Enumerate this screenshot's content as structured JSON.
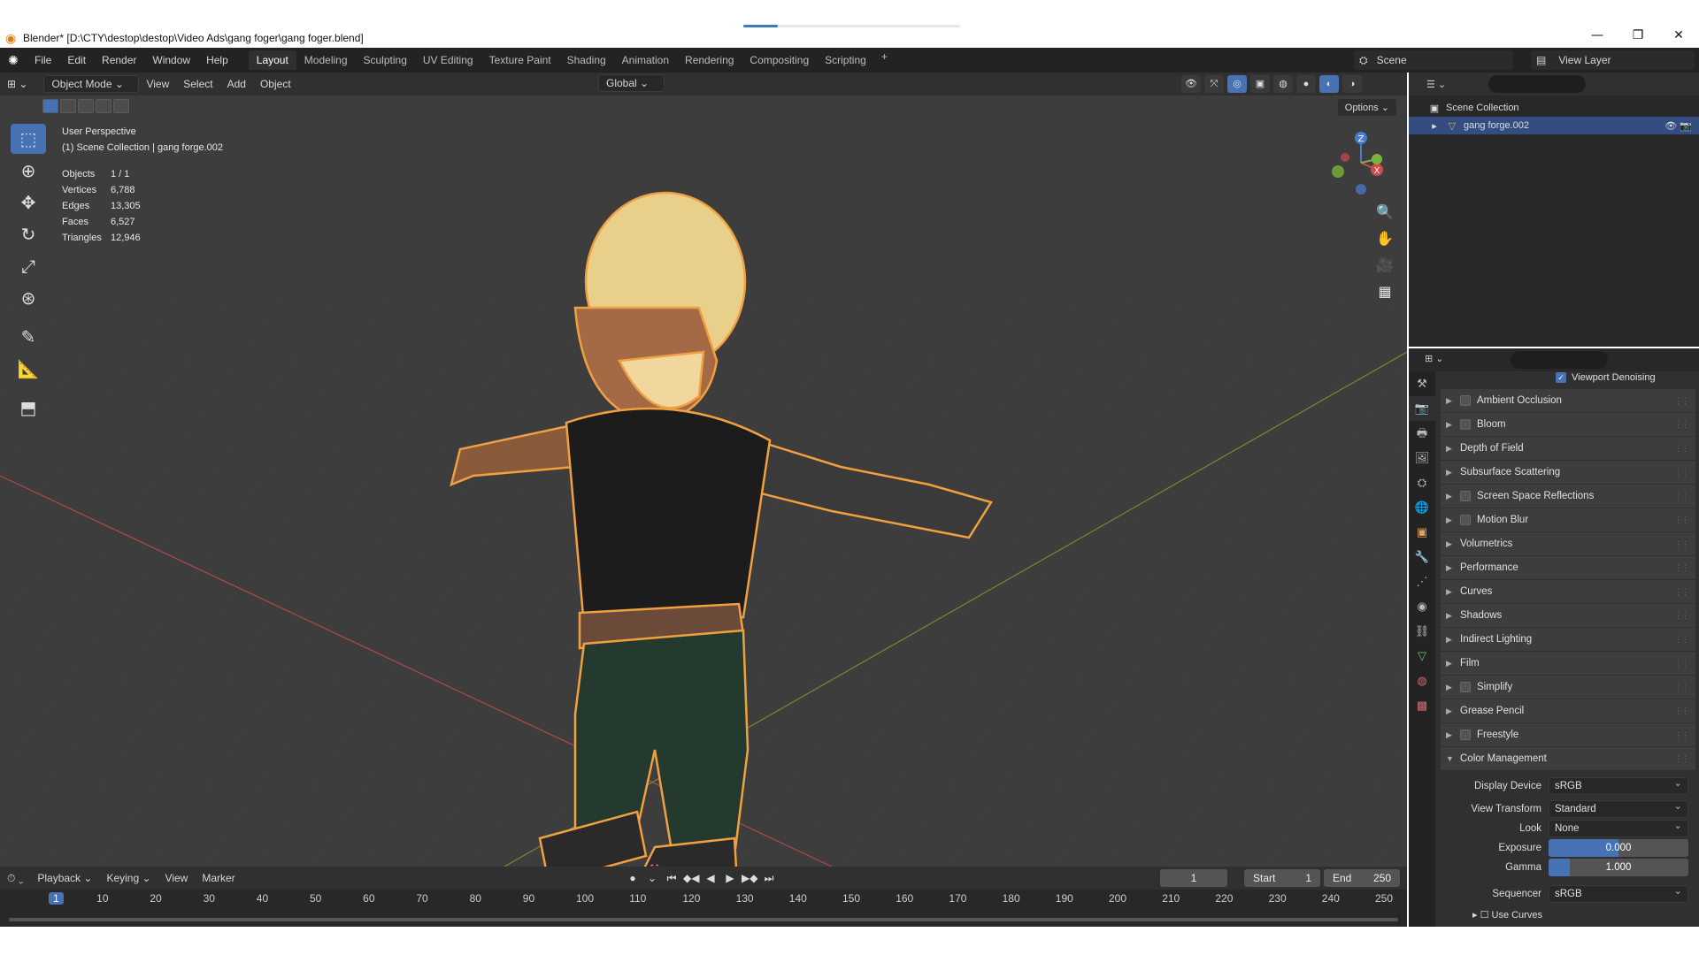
{
  "window": {
    "title": "Blender* [D:\\CTY\\destop\\destop\\Video Ads\\gang foger\\gang  foger.blend]",
    "controls": [
      "—",
      "❐",
      "✕"
    ]
  },
  "topbar": {
    "menus": [
      "File",
      "Edit",
      "Render",
      "Window",
      "Help"
    ],
    "workspaces": [
      "Layout",
      "Modeling",
      "Sculpting",
      "UV Editing",
      "Texture Paint",
      "Shading",
      "Animation",
      "Rendering",
      "Compositing",
      "Scripting"
    ],
    "add_tab": "+",
    "scene": "Scene",
    "view_layer": "View Layer"
  },
  "viewport_header": {
    "mode": "Object Mode",
    "menus": [
      "View",
      "Select",
      "Add",
      "Object"
    ],
    "orientation": "Global",
    "options": "Options"
  },
  "viewport": {
    "perspective": "User Perspective",
    "collection": "(1) Scene Collection | gang forge.002",
    "stats": [
      {
        "k": "Objects",
        "v": "1 / 1"
      },
      {
        "k": "Vertices",
        "v": "6,788"
      },
      {
        "k": "Edges",
        "v": "13,305"
      },
      {
        "k": "Faces",
        "v": "6,527"
      },
      {
        "k": "Triangles",
        "v": "12,946"
      }
    ],
    "gizmo": {
      "z": "Z",
      "x": "X"
    },
    "nav_icons": [
      "zoom-icon",
      "hand-icon",
      "camera-icon",
      "grid-icon"
    ]
  },
  "timeline": {
    "menus": [
      "Playback",
      "Keying",
      "View",
      "Marker"
    ],
    "current_frame": "1",
    "start_label": "Start",
    "start": "1",
    "end_label": "End",
    "end": "250",
    "ticks": [
      "1",
      "10",
      "20",
      "30",
      "40",
      "50",
      "60",
      "70",
      "80",
      "90",
      "100",
      "110",
      "120",
      "130",
      "140",
      "150",
      "160",
      "170",
      "180",
      "190",
      "200",
      "210",
      "220",
      "230",
      "240",
      "250"
    ]
  },
  "outliner": {
    "root": "Scene Collection",
    "object": "gang forge.002"
  },
  "properties": {
    "denoise_label": "Viewport Denoising",
    "panels": [
      {
        "label": "Ambient Occlusion",
        "checkbox": true
      },
      {
        "label": "Bloom",
        "checkbox": true
      },
      {
        "label": "Depth of Field",
        "checkbox": false
      },
      {
        "label": "Subsurface Scattering",
        "checkbox": false
      },
      {
        "label": "Screen Space Reflections",
        "checkbox": true
      },
      {
        "label": "Motion Blur",
        "checkbox": true
      },
      {
        "label": "Volumetrics",
        "checkbox": false
      },
      {
        "label": "Performance",
        "checkbox": false
      },
      {
        "label": "Curves",
        "checkbox": false
      },
      {
        "label": "Shadows",
        "checkbox": false
      },
      {
        "label": "Indirect Lighting",
        "checkbox": false
      },
      {
        "label": "Film",
        "checkbox": false
      },
      {
        "label": "Simplify",
        "checkbox": true
      },
      {
        "label": "Grease Pencil",
        "checkbox": false
      },
      {
        "label": "Freestyle",
        "checkbox": true
      }
    ],
    "color_management": {
      "title": "Color Management",
      "display_device_label": "Display Device",
      "display_device": "sRGB",
      "view_transform_label": "View Transform",
      "view_transform": "Standard",
      "look_label": "Look",
      "look": "None",
      "exposure_label": "Exposure",
      "exposure": "0.000",
      "exposure_fill": 0.5,
      "gamma_label": "Gamma",
      "gamma": "1.000",
      "gamma_fill": 0.15,
      "sequencer_label": "Sequencer",
      "sequencer": "sRGB",
      "use_curves": "Use Curves"
    }
  },
  "colors": {
    "accent": "#4772b3",
    "selection_outline": "#f0a040"
  }
}
